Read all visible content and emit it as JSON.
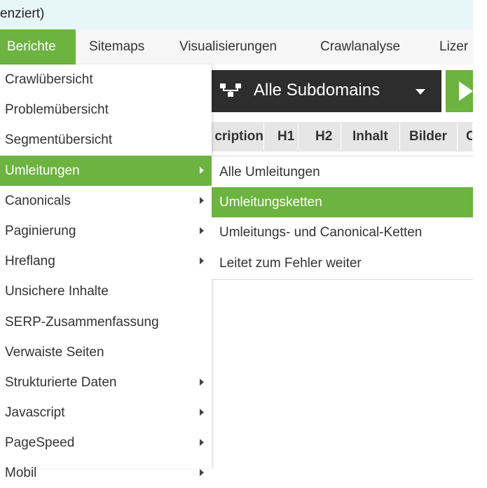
{
  "window": {
    "title_fragment": "enziert)"
  },
  "menubar": {
    "items": [
      {
        "label": "Berichte",
        "active": true
      },
      {
        "label": "Sitemaps"
      },
      {
        "label": "Visualisierungen"
      },
      {
        "label": "Crawlanalyse"
      },
      {
        "label": "Lizer"
      }
    ]
  },
  "toolbar": {
    "subdomain_label": "Alle Subdomains",
    "subdomain_icon": "network-icon",
    "start_icon": "play-icon"
  },
  "tabs": [
    "cription",
    "H1",
    "H2",
    "Inhalt",
    "Bilder",
    "C"
  ],
  "dropdown": {
    "items": [
      {
        "label": "Crawlübersicht",
        "submenu": false
      },
      {
        "label": "Problemübersicht",
        "submenu": false
      },
      {
        "label": "Segmentübersicht",
        "submenu": false
      },
      {
        "label": "Umleitungen",
        "submenu": true,
        "active": true
      },
      {
        "label": "Canonicals",
        "submenu": true
      },
      {
        "label": "Paginierung",
        "submenu": true
      },
      {
        "label": "Hreflang",
        "submenu": true
      },
      {
        "label": "Unsichere Inhalte",
        "submenu": false
      },
      {
        "label": "SERP-Zusammenfassung",
        "submenu": false
      },
      {
        "label": "Verwaiste Seiten",
        "submenu": false
      },
      {
        "label": "Strukturierte Daten",
        "submenu": true
      },
      {
        "label": "Javascript",
        "submenu": true
      },
      {
        "label": "PageSpeed",
        "submenu": true
      },
      {
        "label": "Mobil",
        "submenu": true
      }
    ]
  },
  "submenu": {
    "items": [
      {
        "label": "Alle Umleitungen"
      },
      {
        "label": "Umleitungsketten",
        "active": true
      },
      {
        "label": "Umleitungs- und Canonical-Ketten"
      },
      {
        "label": "Leitet zum Fehler weiter"
      }
    ]
  },
  "colors": {
    "accent": "#6cb33f",
    "dark": "#2d2d2d",
    "titlebar": "#e7f6f9"
  }
}
